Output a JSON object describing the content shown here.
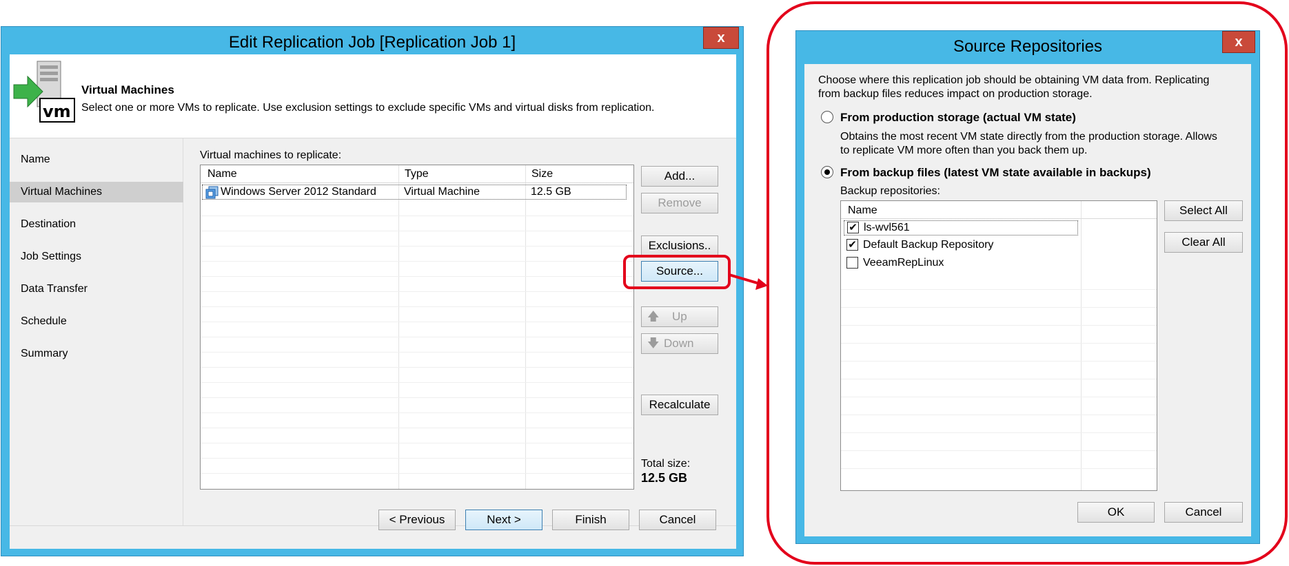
{
  "left_dialog": {
    "title": "Edit Replication Job [Replication Job 1]",
    "close_label": "x",
    "header": {
      "title": "Virtual Machines",
      "description": "Select one or more VMs to replicate. Use exclusion settings to exclude specific VMs and virtual disks from replication."
    },
    "nav": [
      {
        "label": "Name",
        "selected": false
      },
      {
        "label": "Virtual Machines",
        "selected": true
      },
      {
        "label": "Destination",
        "selected": false
      },
      {
        "label": "Job Settings",
        "selected": false
      },
      {
        "label": "Data Transfer",
        "selected": false
      },
      {
        "label": "Schedule",
        "selected": false
      },
      {
        "label": "Summary",
        "selected": false
      }
    ],
    "list_label": "Virtual machines to replicate:",
    "columns": [
      "Name",
      "Type",
      "Size"
    ],
    "rows": [
      {
        "name": "Windows Server 2012 Standard",
        "type": "Virtual Machine",
        "size": "12.5 GB"
      }
    ],
    "buttons": {
      "add": "Add...",
      "remove": "Remove",
      "exclusions": "Exclusions..",
      "source": "Source...",
      "up": "Up",
      "down": "Down",
      "recalculate": "Recalculate"
    },
    "total_label": "Total size:",
    "total_value": "12.5 GB",
    "footer": {
      "previous": "< Previous",
      "next": "Next >",
      "finish": "Finish",
      "cancel": "Cancel"
    }
  },
  "right_dialog": {
    "title": "Source Repositories",
    "close_label": "x",
    "intro": "Choose where this replication job should be obtaining VM data from. Replicating from backup files reduces impact on production storage.",
    "options": [
      {
        "label": "From production storage (actual VM state)",
        "selected": false,
        "description": "Obtains the most recent VM state directly from the production storage. Allows to replicate VM more often than you back them up."
      },
      {
        "label": "From backup files (latest VM state available in backups)",
        "selected": true
      }
    ],
    "repos_label": "Backup repositories:",
    "column": "Name",
    "repositories": [
      {
        "name": "ls-wvl561",
        "checked": true
      },
      {
        "name": "Default Backup Repository",
        "checked": true
      },
      {
        "name": "VeeamRepLinux",
        "checked": false
      }
    ],
    "select_all": "Select All",
    "clear_all": "Clear All",
    "ok": "OK",
    "cancel": "Cancel"
  },
  "colors": {
    "window_frame": "#47b8e6",
    "highlight_red": "#e3001b",
    "close_button": "#c94a3a"
  }
}
